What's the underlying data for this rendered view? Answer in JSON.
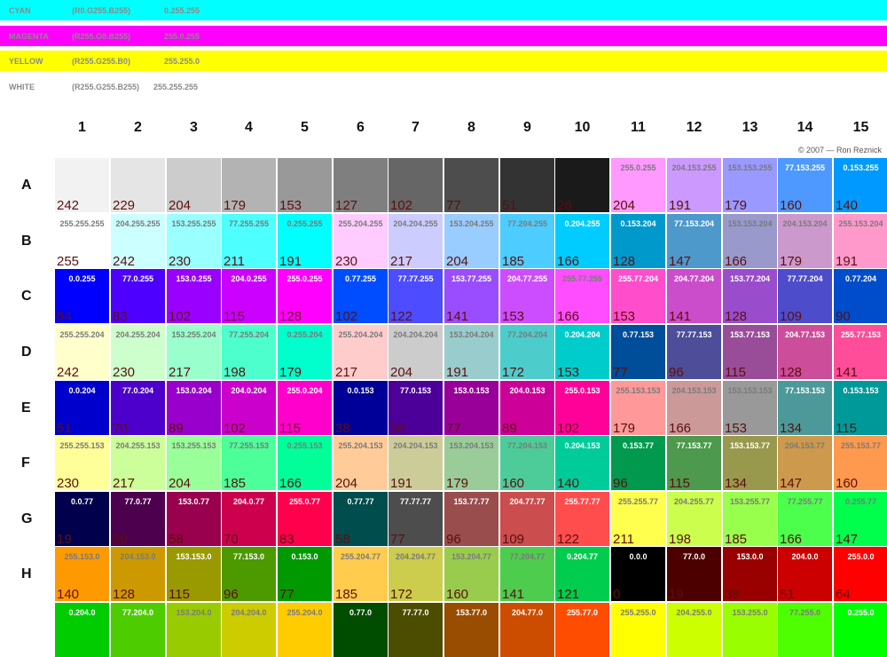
{
  "bands": [
    {
      "name": "CYAN",
      "rgb": "(R0.G255.B255)",
      "hex_code": "0.255.255",
      "color": "#00ffff"
    },
    {
      "name": "MAGENTA",
      "rgb": "(R255.G0.B255)",
      "hex_code": "255.0.255",
      "color": "#ff00ff"
    },
    {
      "name": "YELLOW",
      "rgb": "(R255.G255.B0)",
      "hex_code": "255.255.0",
      "color": "#ffff00"
    },
    {
      "name": "WHITE",
      "rgb": "(R255.G255.B255)",
      "hex_code": "255.255.255",
      "color": "#ffffff"
    }
  ],
  "columns": [
    "1",
    "2",
    "3",
    "4",
    "5",
    "6",
    "7",
    "8",
    "9",
    "10",
    "11",
    "12",
    "13",
    "14",
    "15"
  ],
  "credit": "© 2007 — Ron Reznick",
  "rows": [
    {
      "label": "A",
      "cells": [
        {
          "code": "",
          "value": "242",
          "color": "#f2f2f2"
        },
        {
          "code": "",
          "value": "229",
          "color": "#e5e5e5"
        },
        {
          "code": "",
          "value": "204",
          "color": "#cccccc"
        },
        {
          "code": "",
          "value": "179",
          "color": "#b3b3b3"
        },
        {
          "code": "",
          "value": "153",
          "color": "#999999"
        },
        {
          "code": "",
          "value": "127",
          "color": "#7f7f7f"
        },
        {
          "code": "",
          "value": "102",
          "color": "#666666"
        },
        {
          "code": "",
          "value": "77",
          "color": "#4d4d4d"
        },
        {
          "code": "",
          "value": "51",
          "color": "#333333"
        },
        {
          "code": "",
          "value": "26",
          "color": "#1a1a1a"
        },
        {
          "code": "255.0.255",
          "value": "204",
          "color": "#ff99ff"
        },
        {
          "code": "204.153.255",
          "value": "191",
          "color": "#cc99ff"
        },
        {
          "code": "153.153.255",
          "value": "179",
          "color": "#9999ff"
        },
        {
          "code": "77.153.255",
          "value": "160",
          "color": "#4d99ff"
        },
        {
          "code": "0.153.255",
          "value": "140",
          "color": "#0099ff"
        }
      ]
    },
    {
      "label": "B",
      "cells": [
        {
          "code": "255.255.255",
          "value": "255",
          "color": "#ffffff"
        },
        {
          "code": "204.255.255",
          "value": "242",
          "color": "#ccffff"
        },
        {
          "code": "153.255.255",
          "value": "230",
          "color": "#99ffff"
        },
        {
          "code": "77.255.255",
          "value": "211",
          "color": "#4dffff"
        },
        {
          "code": "0.255.255",
          "value": "191",
          "color": "#00ffff"
        },
        {
          "code": "255.204.255",
          "value": "230",
          "color": "#ffccff"
        },
        {
          "code": "204.204.255",
          "value": "217",
          "color": "#ccccff"
        },
        {
          "code": "153.204.255",
          "value": "204",
          "color": "#99ccff"
        },
        {
          "code": "77.204.255",
          "value": "185",
          "color": "#4dccff"
        },
        {
          "code": "0.204.255",
          "value": "166",
          "color": "#00ccff"
        },
        {
          "code": "0.153.204",
          "value": "128",
          "color": "#0099cc"
        },
        {
          "code": "77.153.204",
          "value": "147",
          "color": "#4d99cc"
        },
        {
          "code": "153.153.204",
          "value": "166",
          "color": "#9999cc"
        },
        {
          "code": "204.153.204",
          "value": "179",
          "color": "#cc99cc"
        },
        {
          "code": "255.153.204",
          "value": "191",
          "color": "#ff99cc"
        }
      ]
    },
    {
      "label": "C",
      "cells": [
        {
          "code": "0.0.255",
          "value": "64",
          "color": "#0000ff"
        },
        {
          "code": "77.0.255",
          "value": "83",
          "color": "#4d00ff"
        },
        {
          "code": "153.0.255",
          "value": "102",
          "color": "#9900ff"
        },
        {
          "code": "204.0.255",
          "value": "115",
          "color": "#cc00ff"
        },
        {
          "code": "255.0.255",
          "value": "128",
          "color": "#ff00ff"
        },
        {
          "code": "0.77.255",
          "value": "102",
          "color": "#004dff"
        },
        {
          "code": "77.77.255",
          "value": "122",
          "color": "#4d4dff"
        },
        {
          "code": "153.77.255",
          "value": "141",
          "color": "#994dff"
        },
        {
          "code": "204.77.255",
          "value": "153",
          "color": "#cc4dff"
        },
        {
          "code": "255.77.255",
          "value": "166",
          "color": "#ff4dff"
        },
        {
          "code": "255.77.204",
          "value": "153",
          "color": "#ff4dcc"
        },
        {
          "code": "204.77.204",
          "value": "141",
          "color": "#cc4dcc"
        },
        {
          "code": "153.77.204",
          "value": "128",
          "color": "#994dcc"
        },
        {
          "code": "77.77.204",
          "value": "109",
          "color": "#4d4dcc"
        },
        {
          "code": "0.77.204",
          "value": "90",
          "color": "#004dcc"
        }
      ]
    },
    {
      "label": "D",
      "cells": [
        {
          "code": "255.255.204",
          "value": "242",
          "color": "#ffffcc"
        },
        {
          "code": "204.255.204",
          "value": "230",
          "color": "#ccffcc"
        },
        {
          "code": "153.255.204",
          "value": "217",
          "color": "#99ffcc"
        },
        {
          "code": "77.255.204",
          "value": "198",
          "color": "#4dffcc"
        },
        {
          "code": "0.255.204",
          "value": "179",
          "color": "#00ffcc"
        },
        {
          "code": "255.204.204",
          "value": "217",
          "color": "#ffcccc"
        },
        {
          "code": "204.204.204",
          "value": "204",
          "color": "#cccccc"
        },
        {
          "code": "153.204.204",
          "value": "191",
          "color": "#99cccc"
        },
        {
          "code": "77.204.204",
          "value": "172",
          "color": "#4dcccc"
        },
        {
          "code": "0.204.204",
          "value": "153",
          "color": "#00cccc"
        },
        {
          "code": "0.77.153",
          "value": "77",
          "color": "#004d99"
        },
        {
          "code": "77.77.153",
          "value": "96",
          "color": "#4d4d99"
        },
        {
          "code": "153.77.153",
          "value": "115",
          "color": "#994d99"
        },
        {
          "code": "204.77.153",
          "value": "128",
          "color": "#cc4d99"
        },
        {
          "code": "255.77.153",
          "value": "141",
          "color": "#ff4d99"
        }
      ]
    },
    {
      "label": "E",
      "cells": [
        {
          "code": "0.0.204",
          "value": "51",
          "color": "#0000cc"
        },
        {
          "code": "77.0.204",
          "value": "70",
          "color": "#4d00cc"
        },
        {
          "code": "153.0.204",
          "value": "89",
          "color": "#9900cc"
        },
        {
          "code": "204.0.204",
          "value": "102",
          "color": "#cc00cc"
        },
        {
          "code": "255.0.204",
          "value": "115",
          "color": "#ff00cc"
        },
        {
          "code": "0.0.153",
          "value": "38",
          "color": "#000099"
        },
        {
          "code": "77.0.153",
          "value": "58",
          "color": "#4d0099"
        },
        {
          "code": "153.0.153",
          "value": "77",
          "color": "#990099"
        },
        {
          "code": "204.0.153",
          "value": "89",
          "color": "#cc0099"
        },
        {
          "code": "255.0.153",
          "value": "102",
          "color": "#ff0099"
        },
        {
          "code": "255.153.153",
          "value": "179",
          "color": "#ff9999"
        },
        {
          "code": "204.153.153",
          "value": "166",
          "color": "#cc9999"
        },
        {
          "code": "153.153.153",
          "value": "153",
          "color": "#999999"
        },
        {
          "code": "77.153.153",
          "value": "134",
          "color": "#4d9999"
        },
        {
          "code": "0.153.153",
          "value": "115",
          "color": "#009999"
        }
      ]
    },
    {
      "label": "F",
      "cells": [
        {
          "code": "255.255.153",
          "value": "230",
          "color": "#ffff99"
        },
        {
          "code": "204.255.153",
          "value": "217",
          "color": "#ccff99"
        },
        {
          "code": "153.255.153",
          "value": "204",
          "color": "#99ff99"
        },
        {
          "code": "77.255.153",
          "value": "185",
          "color": "#4dff99"
        },
        {
          "code": "0.255.153",
          "value": "166",
          "color": "#00ff99"
        },
        {
          "code": "255.204.153",
          "value": "204",
          "color": "#ffcc99"
        },
        {
          "code": "204.204.153",
          "value": "191",
          "color": "#cccc99"
        },
        {
          "code": "153.204.153",
          "value": "179",
          "color": "#99cc99"
        },
        {
          "code": "77.204.153",
          "value": "160",
          "color": "#4dcc99"
        },
        {
          "code": "0.204.153",
          "value": "140",
          "color": "#00cc99"
        },
        {
          "code": "0.153.77",
          "value": "96",
          "color": "#00994d"
        },
        {
          "code": "77.153.77",
          "value": "115",
          "color": "#4d994d"
        },
        {
          "code": "153.153.77",
          "value": "134",
          "color": "#99994d"
        },
        {
          "code": "204.153.77",
          "value": "147",
          "color": "#cc994d"
        },
        {
          "code": "255.153.77",
          "value": "160",
          "color": "#ff994d"
        }
      ]
    },
    {
      "label": "G",
      "cells": [
        {
          "code": "0.0.77",
          "value": "19",
          "color": "#00004d"
        },
        {
          "code": "77.0.77",
          "value": "39",
          "color": "#4d004d"
        },
        {
          "code": "153.0.77",
          "value": "58",
          "color": "#99004d"
        },
        {
          "code": "204.0.77",
          "value": "70",
          "color": "#cc004d"
        },
        {
          "code": "255.0.77",
          "value": "83",
          "color": "#ff004d"
        },
        {
          "code": "0.77.77",
          "value": "58",
          "color": "#004d4d"
        },
        {
          "code": "77.77.77",
          "value": "77",
          "color": "#4d4d4d"
        },
        {
          "code": "153.77.77",
          "value": "96",
          "color": "#994d4d"
        },
        {
          "code": "204.77.77",
          "value": "109",
          "color": "#cc4d4d"
        },
        {
          "code": "255.77.77",
          "value": "122",
          "color": "#ff4d4d"
        },
        {
          "code": "255.255.77",
          "value": "211",
          "color": "#ffff4d"
        },
        {
          "code": "204.255.77",
          "value": "198",
          "color": "#ccff4d"
        },
        {
          "code": "153.255.77",
          "value": "185",
          "color": "#99ff4d"
        },
        {
          "code": "77.255.77",
          "value": "166",
          "color": "#4dff4d"
        },
        {
          "code": "0.255.77",
          "value": "147",
          "color": "#00ff4d"
        }
      ]
    },
    {
      "label": "H",
      "cells": [
        {
          "code": "255.153.0",
          "value": "140",
          "color": "#ff9900"
        },
        {
          "code": "204.153.0",
          "value": "128",
          "color": "#cc9900"
        },
        {
          "code": "153.153.0",
          "value": "115",
          "color": "#999900"
        },
        {
          "code": "77.153.0",
          "value": "96",
          "color": "#4d9900"
        },
        {
          "code": "0.153.0",
          "value": "77",
          "color": "#009900"
        },
        {
          "code": "255.204.77",
          "value": "185",
          "color": "#ffcc4d"
        },
        {
          "code": "204.204.77",
          "value": "172",
          "color": "#cccc4d"
        },
        {
          "code": "153.204.77",
          "value": "160",
          "color": "#99cc4d"
        },
        {
          "code": "77.204.77",
          "value": "141",
          "color": "#4dcc4d"
        },
        {
          "code": "0.204.77",
          "value": "121",
          "color": "#00cc4d"
        },
        {
          "code": "0.0.0",
          "value": "0",
          "color": "#000000"
        },
        {
          "code": "77.0.0",
          "value": "19",
          "color": "#4d0000"
        },
        {
          "code": "153.0.0",
          "value": "38",
          "color": "#990000"
        },
        {
          "code": "204.0.0",
          "value": "51",
          "color": "#cc0000"
        },
        {
          "code": "255.0.0",
          "value": "64",
          "color": "#ff0000"
        }
      ]
    },
    {
      "label": "",
      "cells": [
        {
          "code": "0.204.0",
          "value": "",
          "color": "#00cc00"
        },
        {
          "code": "77.204.0",
          "value": "",
          "color": "#4dcc00"
        },
        {
          "code": "153.204.0",
          "value": "",
          "color": "#99cc00"
        },
        {
          "code": "204.204.0",
          "value": "",
          "color": "#cccc00"
        },
        {
          "code": "255.204.0",
          "value": "",
          "color": "#ffcc00"
        },
        {
          "code": "0.77.0",
          "value": "",
          "color": "#004d00"
        },
        {
          "code": "77.77.0",
          "value": "",
          "color": "#4d4d00"
        },
        {
          "code": "153.77.0",
          "value": "",
          "color": "#994d00"
        },
        {
          "code": "204.77.0",
          "value": "",
          "color": "#cc4d00"
        },
        {
          "code": "255.77.0",
          "value": "",
          "color": "#ff4d00"
        },
        {
          "code": "255.255.0",
          "value": "",
          "color": "#ffff00"
        },
        {
          "code": "204.255.0",
          "value": "",
          "color": "#ccff00"
        },
        {
          "code": "153.255.0",
          "value": "",
          "color": "#99ff00"
        },
        {
          "code": "77.255.0",
          "value": "",
          "color": "#4dff00"
        },
        {
          "code": "0.255.0",
          "value": "",
          "color": "#00ff00"
        }
      ]
    }
  ]
}
